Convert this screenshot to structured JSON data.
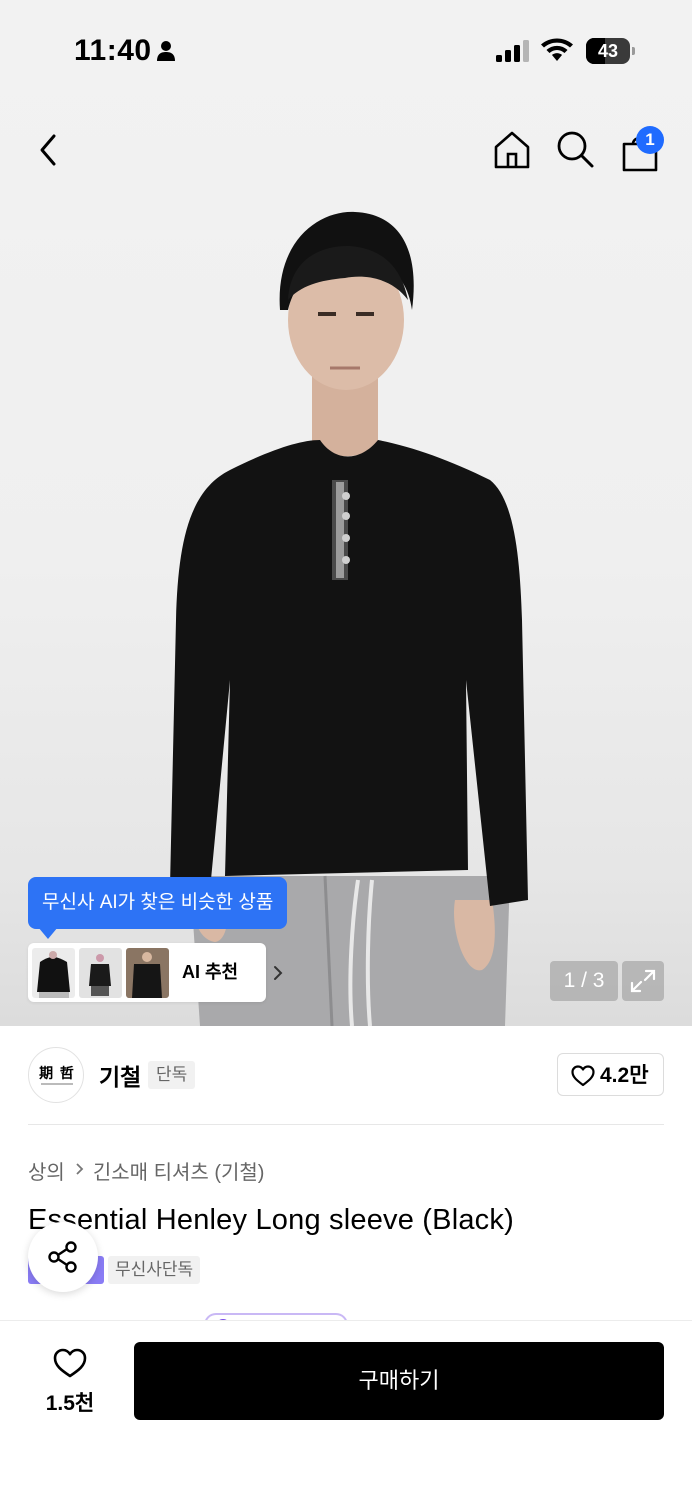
{
  "status_bar": {
    "time": "11:40",
    "battery_level": "43",
    "battery_fraction": 0.43
  },
  "nav": {
    "cart_count": "1",
    "icons": [
      "chevron-left-icon",
      "home-icon",
      "search-icon",
      "shopping-bag-icon"
    ]
  },
  "gallery": {
    "page_indicator": "1 / 3",
    "current_page": 1,
    "total_pages": 3
  },
  "ai_recommend": {
    "tooltip": "무신사 AI가 찾은 비슷한 상품",
    "label": "AI 추천"
  },
  "brand": {
    "logo_text": "期 哲",
    "name": "기철",
    "exclusive_tag": "단독",
    "like_count": "4.2만"
  },
  "breadcrumb": {
    "category": "상의",
    "subcategory": "긴소매 티셔츠 (기철)"
  },
  "product": {
    "title": "Essential Henley Long sleeve (Black)",
    "tag": "무신사단독"
  },
  "bottom_bar": {
    "wish_count": "1.5천",
    "buy_label": "구매하기"
  },
  "colors": {
    "accent_blue": "#2d73f5",
    "badge_blue": "#1f6bff",
    "purple_tag": "#8a7cf5",
    "buy_button": "#000000"
  }
}
